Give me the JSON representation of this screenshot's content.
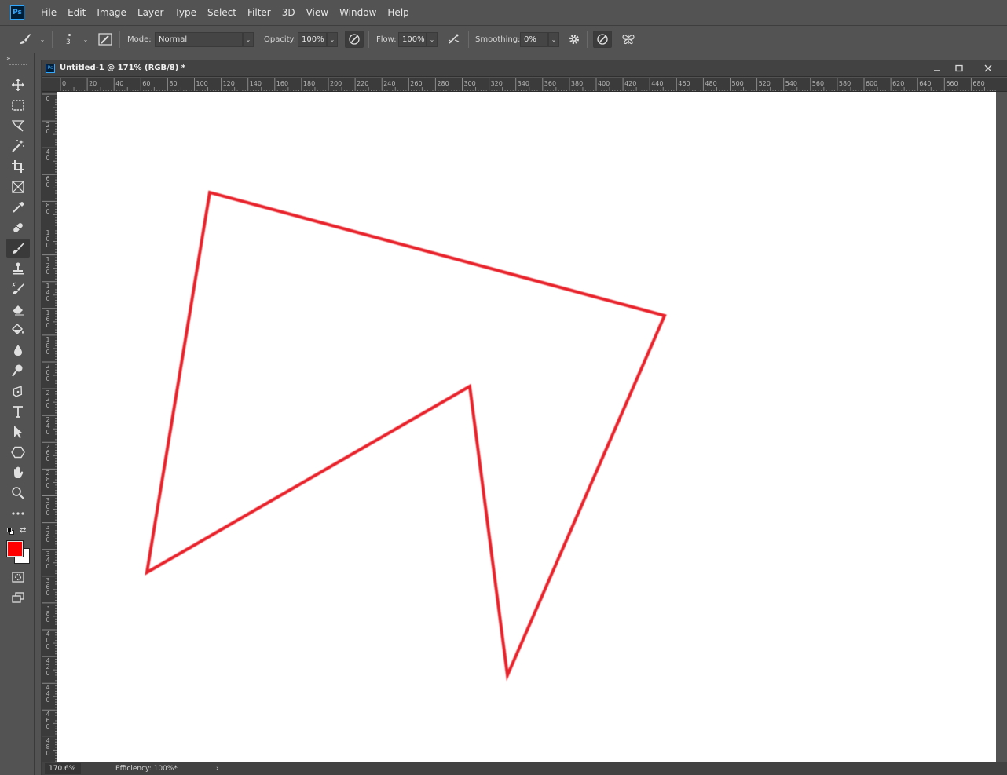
{
  "app": {
    "logo_text": "Ps",
    "menu": [
      "File",
      "Edit",
      "Image",
      "Layer",
      "Type",
      "Select",
      "Filter",
      "3D",
      "View",
      "Window",
      "Help"
    ]
  },
  "options": {
    "brush_size": "3",
    "mode_label": "Mode:",
    "mode_value": "Normal",
    "opacity_label": "Opacity:",
    "opacity_value": "100%",
    "flow_label": "Flow:",
    "flow_value": "100%",
    "smoothing_label": "Smoothing:",
    "smoothing_value": "0%"
  },
  "toolbar": {
    "collapse": "»",
    "tools": [
      "move-tool",
      "marquee-tool",
      "lasso-tool",
      "magic-wand-tool",
      "crop-tool",
      "frame-tool",
      "eyedropper-tool",
      "healing-brush-tool",
      "brush-tool",
      "clone-stamp-tool",
      "history-brush-tool",
      "eraser-tool",
      "paint-bucket-tool",
      "blur-tool",
      "dodge-tool",
      "pen-tool",
      "type-tool",
      "path-selection-tool",
      "shape-tool",
      "hand-tool",
      "zoom-tool",
      "more-tools"
    ],
    "active_tool": "brush-tool",
    "foreground_color": "#ff0000",
    "background_color": "#ffffff"
  },
  "document": {
    "title": "Untitled-1 @ 171% (RGB/8) *",
    "zoom": "170.6%",
    "status": "Efficiency: 100%*",
    "ruler_top": [
      "0",
      "20",
      "40",
      "60",
      "80",
      "100",
      "120",
      "140",
      "160",
      "180",
      "200",
      "220",
      "240",
      "260",
      "280",
      "300",
      "320",
      "340",
      "360",
      "380",
      "400",
      "420",
      "440",
      "460",
      "480",
      "500",
      "520",
      "540",
      "560",
      "580",
      "600",
      "620",
      "640",
      "660",
      "680"
    ],
    "ruler_left": [
      "0",
      "20",
      "40",
      "60",
      "80",
      "100",
      "120",
      "140",
      "160",
      "180",
      "200",
      "220",
      "240",
      "260",
      "280",
      "300",
      "320",
      "340",
      "360",
      "380",
      "400",
      "420",
      "440",
      "460",
      "480"
    ],
    "stroke_color": "#e8242c"
  }
}
